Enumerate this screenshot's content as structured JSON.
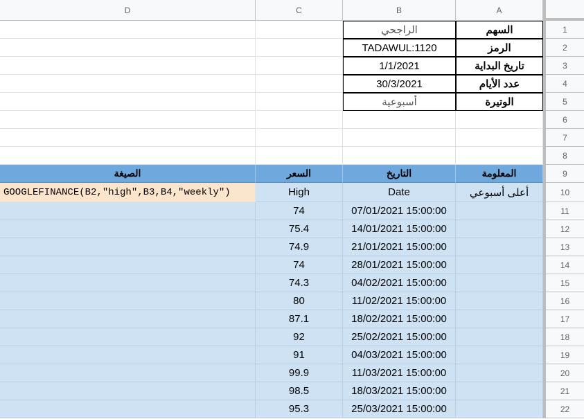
{
  "column_headers": [
    "D",
    "C",
    "B",
    "A"
  ],
  "row_numbers": [
    "1",
    "2",
    "3",
    "4",
    "5",
    "6",
    "7",
    "8",
    "9",
    "10",
    "11",
    "12",
    "13",
    "14",
    "15",
    "16",
    "17",
    "18",
    "19",
    "20",
    "21",
    "22"
  ],
  "params": [
    {
      "label": "السهم",
      "value": "الراجحي"
    },
    {
      "label": "الرمز",
      "value": "TADAWUL:1120"
    },
    {
      "label": "تاريخ البداية",
      "value": "1/1/2021"
    },
    {
      "label": "عدد الأيام",
      "value": "30/3/2021"
    },
    {
      "label": "الوتيرة",
      "value": "أسبوعية"
    }
  ],
  "table_header": {
    "info": "المعلومة",
    "date": "التاريخ",
    "price": "السعر",
    "formula": "الصيغة"
  },
  "first_row": {
    "info": "أعلى أسبوعي",
    "date": "Date",
    "price": "High",
    "formula": "GOOGLEFINANCE(B2,\"high\",B3,B4,\"weekly\")"
  },
  "rows": [
    {
      "date": "07/01/2021 15:00:00",
      "price": "74"
    },
    {
      "date": "14/01/2021 15:00:00",
      "price": "75.4"
    },
    {
      "date": "21/01/2021 15:00:00",
      "price": "74.9"
    },
    {
      "date": "28/01/2021 15:00:00",
      "price": "74"
    },
    {
      "date": "04/02/2021 15:00:00",
      "price": "74.3"
    },
    {
      "date": "11/02/2021 15:00:00",
      "price": "80"
    },
    {
      "date": "18/02/2021 15:00:00",
      "price": "87.1"
    },
    {
      "date": "25/02/2021 15:00:00",
      "price": "92"
    },
    {
      "date": "04/03/2021 15:00:00",
      "price": "91"
    },
    {
      "date": "11/03/2021 15:00:00",
      "price": "99.9"
    },
    {
      "date": "18/03/2021 15:00:00",
      "price": "98.5"
    },
    {
      "date": "25/03/2021 15:00:00",
      "price": "95.3"
    }
  ]
}
